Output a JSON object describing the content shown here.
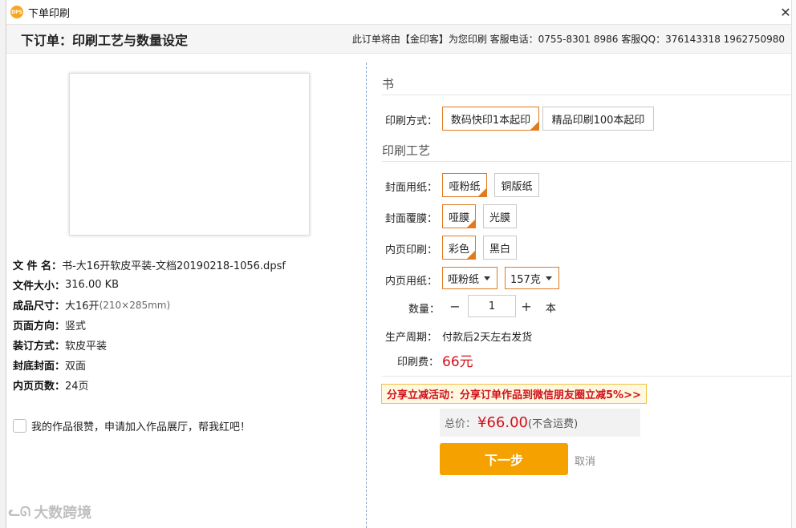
{
  "window": {
    "title": "下单印刷",
    "icon_text": "DPS"
  },
  "header": {
    "title": "下订单：印刷工艺与数量设定",
    "info": "此订单将由【金印客】为您印刷 客服电话：0755-8301 8986 客服QQ：376143318 1962750980"
  },
  "file_info": {
    "name_label": "文  件  名：",
    "name_value": "书-大16开软皮平装-文档20190218-1056.dpsf",
    "size_label": "文件大小：",
    "size_value": "316.00 KB",
    "dim_label": "成品尺寸：",
    "dim_value": "大16开",
    "dim_sub": "(210×285mm)",
    "orient_label": "页面方向：",
    "orient_value": "竖式",
    "binding_label": "装订方式：",
    "binding_value": "软皮平装",
    "cover_label": "封底封面：",
    "cover_value": "双面",
    "pages_label": "内页页数：",
    "pages_value": "24页"
  },
  "showcase_text": "我的作品很赞，申请加入作品展厅，帮我红吧！",
  "watermark": "大数跨境",
  "product": {
    "section_title": "书",
    "method_label": "印刷方式：",
    "method_options": [
      "数码快印1本起印",
      "精品印刷100本起印"
    ]
  },
  "craft": {
    "section_title": "印刷工艺",
    "cover_paper_label": "封面用纸：",
    "cover_paper_options": [
      "哑粉纸",
      "铜版纸"
    ],
    "cover_film_label": "封面覆膜：",
    "cover_film_options": [
      "哑膜",
      "光膜"
    ],
    "inner_print_label": "内页印刷：",
    "inner_print_options": [
      "彩色",
      "黑白"
    ],
    "inner_paper_label": "内页用纸：",
    "inner_paper_value": "哑粉纸",
    "inner_weight_value": "157克",
    "qty_label": "数量：",
    "qty_minus": "−",
    "qty_value": "1",
    "qty_plus": "+",
    "qty_unit": "本",
    "cycle_label": "生产周期：",
    "cycle_value": "付款后2天左右发货",
    "fee_label": "印刷费：",
    "fee_value": "66元"
  },
  "promo": "分享立减活动：分享订单作品到微信朋友圈立减5%>>",
  "total": {
    "label": "总价：",
    "amount": "¥66.00",
    "note": "(不含运费)"
  },
  "actions": {
    "next": "下一步",
    "cancel": "取消"
  },
  "colors": {
    "accent": "#e07a1f",
    "button": "#f5a200",
    "price": "#d0121b"
  }
}
